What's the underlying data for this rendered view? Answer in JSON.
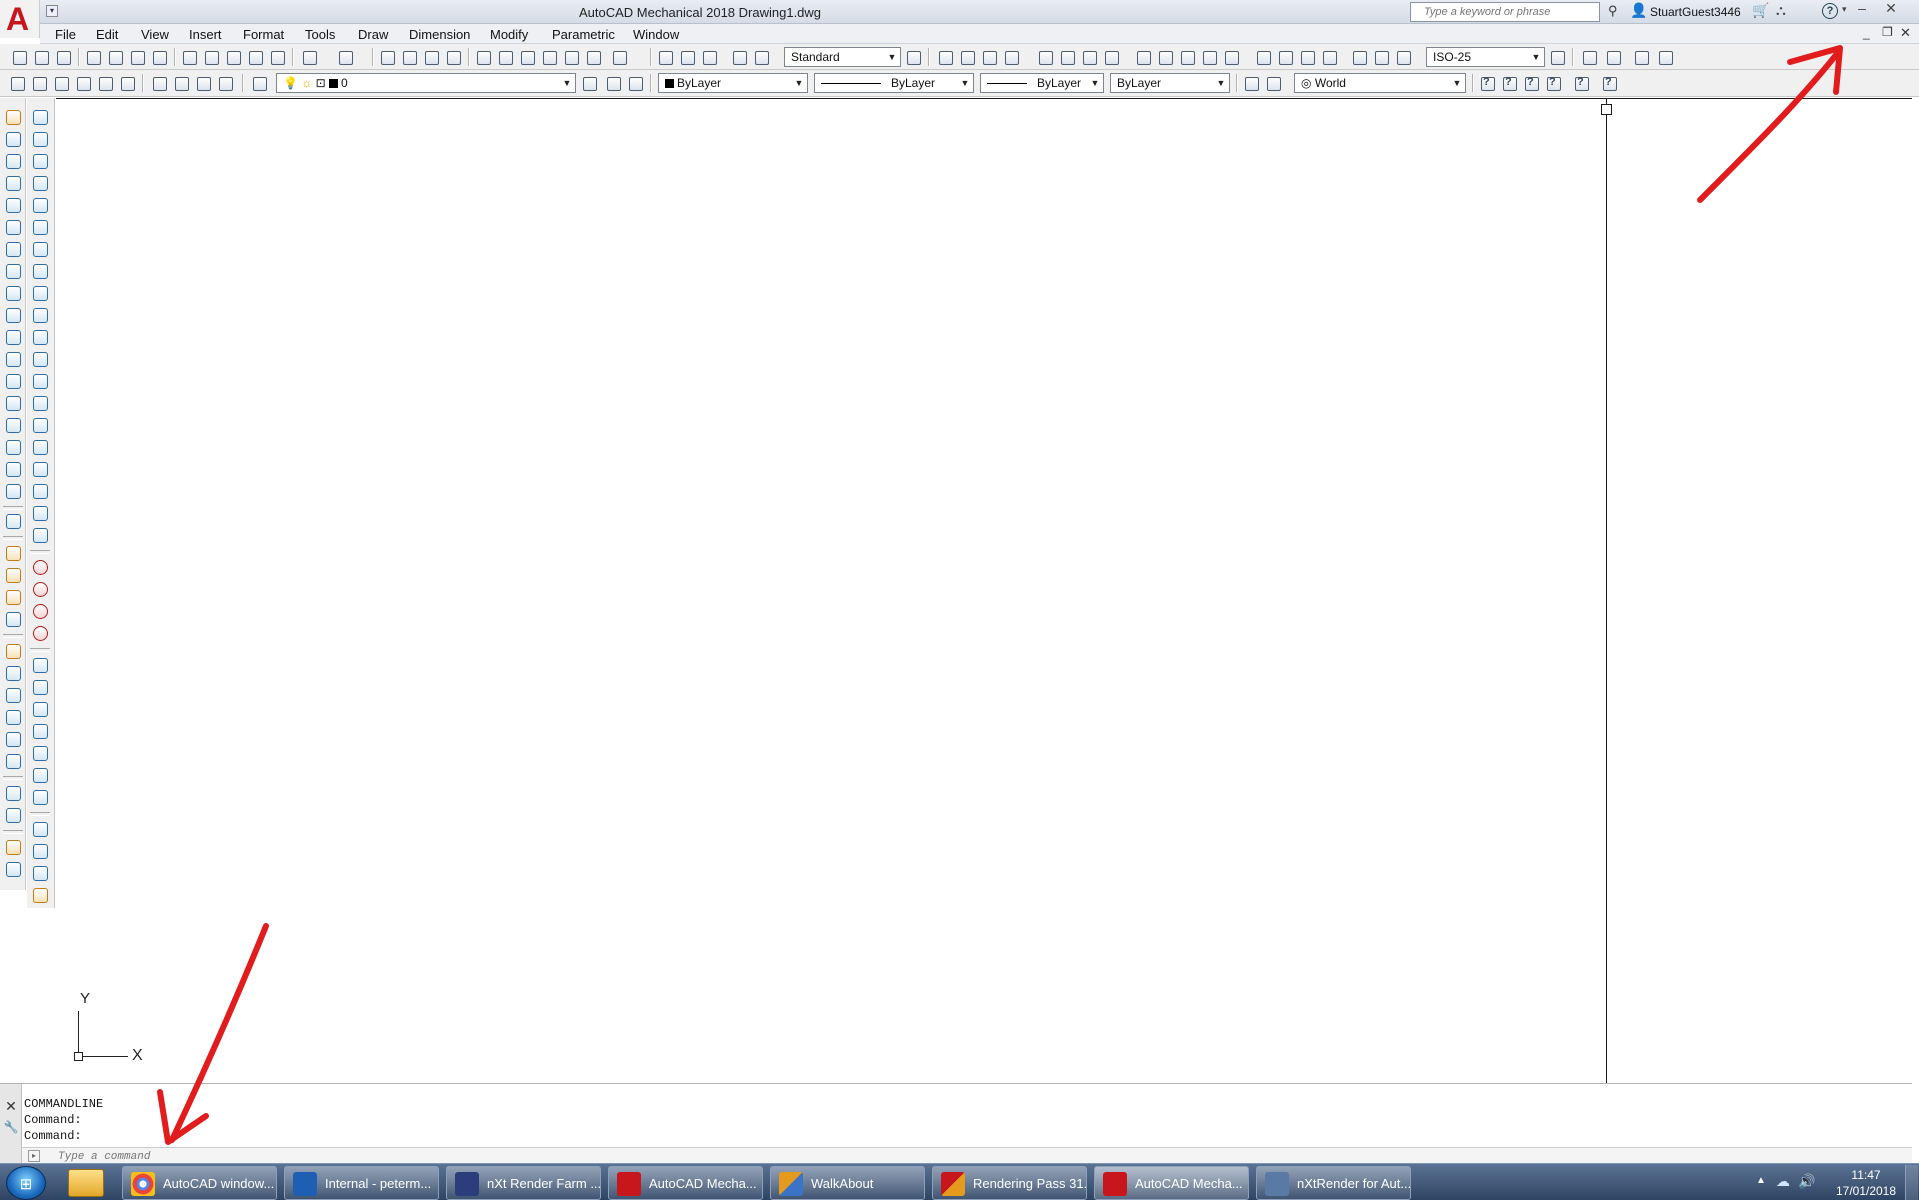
{
  "window": {
    "title": "AutoCAD Mechanical 2018    Drawing1.dwg",
    "app_logo": "A",
    "search_placeholder": "Type a keyword or phrase",
    "user_name": "StuartGuest3446",
    "help_label": "?",
    "minimize_glyph": "‒",
    "close_glyph": "✕"
  },
  "menubar": {
    "items": [
      "File",
      "Edit",
      "View",
      "Insert",
      "Format",
      "Tools",
      "Draw",
      "Dimension",
      "Modify",
      "Parametric",
      "Window"
    ],
    "doc_minimize": "_",
    "doc_restore": "❐",
    "doc_close": "✕"
  },
  "toolbar1": {
    "text_style": "Standard",
    "dim_style": "ISO-25"
  },
  "toolbar2": {
    "layer": "0",
    "color": "ByLayer",
    "linetype": "ByLayer",
    "lineweight": "ByLayer",
    "plotstyle": "ByLayer",
    "ucs": "World",
    "help_buttons": [
      "?",
      "?",
      "?",
      "?",
      "?",
      "?"
    ]
  },
  "drawing": {
    "ucs_y_label": "Y",
    "ucs_x_label": "X"
  },
  "command_line": {
    "history": [
      "COMMANDLINE",
      "Command:",
      "Command:"
    ],
    "placeholder": "Type a command",
    "close_glyph": "✕",
    "wrench_glyph": "🔧"
  },
  "taskbar": {
    "start_glyph": "⊞",
    "buttons": [
      {
        "label": "AutoCAD window...",
        "icon": "chrome-icon",
        "color": "#e8453c"
      },
      {
        "label": "Internal - peterm...",
        "icon": "outlook-icon",
        "color": "#1f5fb3"
      },
      {
        "label": "nXt Render Farm ...",
        "icon": "render-farm-icon",
        "color": "#2b3d7a"
      },
      {
        "label": "AutoCAD Mecha...",
        "icon": "autocad-icon",
        "color": "#c8161d"
      },
      {
        "label": "WalkAbout",
        "icon": "walkabout-icon",
        "color": "#e49a1c"
      },
      {
        "label": "Rendering Pass 31...",
        "icon": "rendering-icon",
        "color": "#e49a1c"
      },
      {
        "label": "AutoCAD Mecha...",
        "icon": "autocad-icon",
        "color": "#c8161d"
      },
      {
        "label": "nXtRender for Aut...",
        "icon": "nxtrender-icon",
        "color": "#5a7aa6"
      }
    ],
    "tray_arrow": "▲",
    "tray_cloud": "☁",
    "tray_sound": "🔊",
    "time": "11:47",
    "date": "17/01/2018"
  },
  "colors": {
    "annotation_red": "#e21c1c",
    "autocad_red": "#c8161d"
  }
}
